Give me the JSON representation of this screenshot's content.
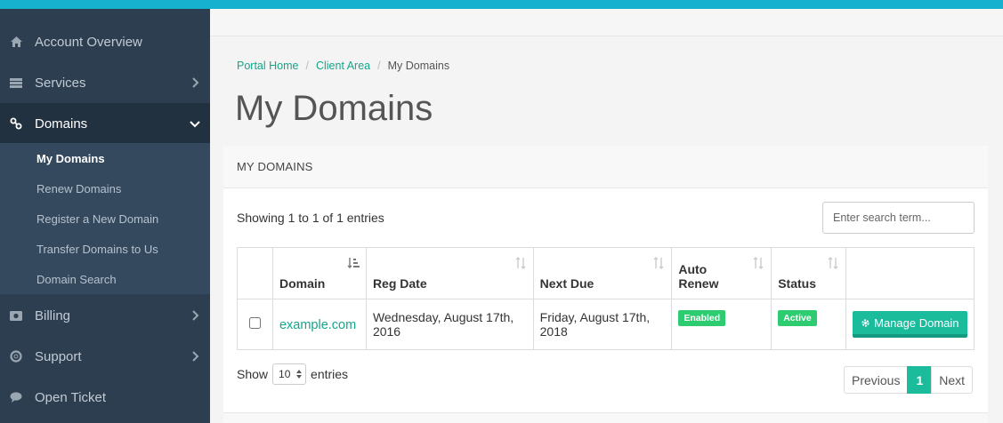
{
  "sidebar": {
    "items": [
      {
        "label": "Account Overview",
        "icon": "home-icon"
      },
      {
        "label": "Services",
        "icon": "services-icon"
      },
      {
        "label": "Domains",
        "icon": "link-icon"
      },
      {
        "label": "Billing",
        "icon": "billing-icon"
      },
      {
        "label": "Support",
        "icon": "lifebuoy-icon"
      },
      {
        "label": "Open Ticket",
        "icon": "comment-icon"
      }
    ],
    "domains_submenu": [
      {
        "label": "My Domains"
      },
      {
        "label": "Renew Domains"
      },
      {
        "label": "Register a New Domain"
      },
      {
        "label": "Transfer Domains to Us"
      },
      {
        "label": "Domain Search"
      }
    ]
  },
  "breadcrumb": {
    "items": [
      "Portal Home",
      "Client Area",
      "My Domains"
    ],
    "separator": "/"
  },
  "page_title": "My Domains",
  "panel": {
    "title": "MY DOMAINS",
    "showing": "Showing 1 to 1 of 1 entries",
    "search_placeholder": "Enter search term...",
    "columns": {
      "domain": "Domain",
      "reg_date": "Reg Date",
      "next_due": "Next Due",
      "auto_renew_line1": "Auto",
      "auto_renew_line2": "Renew",
      "status": "Status"
    },
    "rows": [
      {
        "domain": "example.com",
        "reg_date_line1": "Wednesday, August 17th,",
        "reg_date_line2": "2016",
        "next_due_line1": "Friday, August 17th,",
        "next_due_line2": "2018",
        "auto_renew": "Enabled",
        "status": "Active",
        "action": "Manage Domain"
      }
    ],
    "length": {
      "show_label": "Show",
      "value": "10",
      "entries_label": "entries"
    },
    "pagination": {
      "previous": "Previous",
      "current": "1",
      "next": "Next"
    }
  },
  "colors": {
    "accent": "#1abc9c",
    "topbar": "#15b1cf",
    "sidebar": "#2c3e50",
    "badge": "#2ecc71"
  }
}
